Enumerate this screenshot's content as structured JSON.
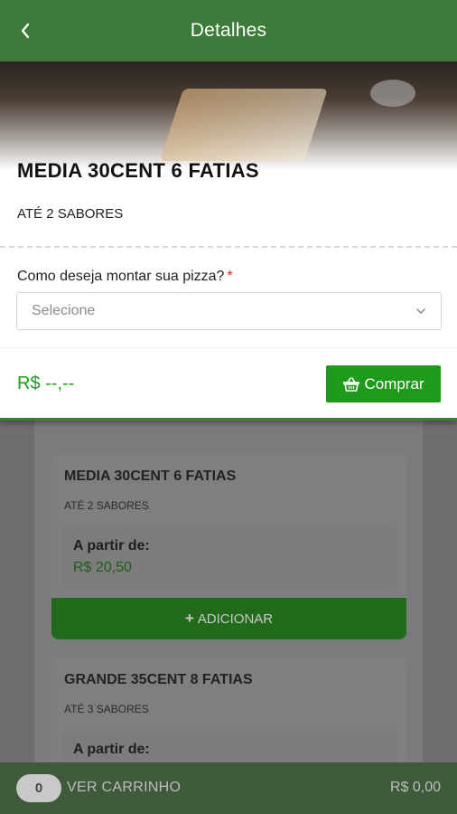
{
  "header": {
    "title": "Detalhes",
    "back_icon": "chevron-left-icon"
  },
  "product": {
    "name": "MEDIA 30CENT 6 FATIAS",
    "subtitle": "ATÉ 2 SABORES",
    "question": "Como deseja montar sua pizza?",
    "required_mark": "*",
    "select_placeholder": "Selecione",
    "price": "R$ --,--",
    "buy_label": "Comprar",
    "buy_icon": "basket-icon"
  },
  "list": {
    "cards": [
      {
        "title": "MEDIA 30CENT 6 FATIAS",
        "subtitle": "ATÉ 2 SABORES",
        "from_label": "A partir de:",
        "from_price": "R$ 20,50",
        "add_label": "ADICIONAR"
      },
      {
        "title": "GRANDE 35CENT 8 FATIAS",
        "subtitle": "ATÉ 3 SABORES",
        "from_label": "A partir de:"
      }
    ]
  },
  "footer": {
    "cart_count": "0",
    "cart_label": "VER CARRINHO",
    "total": "R$ 0,00"
  },
  "colors": {
    "primary_green": "#3e7a3a",
    "accent_green": "#1f9a1a",
    "required_red": "#d22222"
  }
}
